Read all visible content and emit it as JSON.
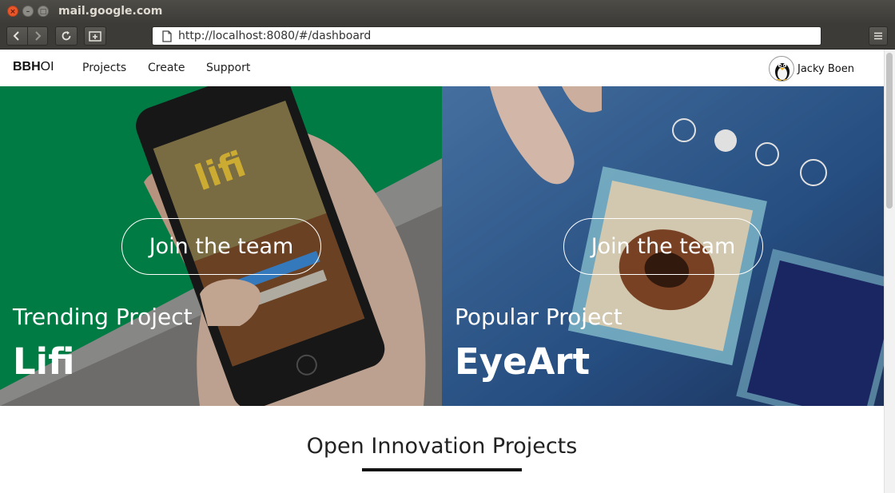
{
  "window": {
    "title": "mail.google.com",
    "buttons": {
      "close": "×",
      "minimize": "–",
      "maximize": "□"
    }
  },
  "browser": {
    "url": "http://localhost:8080/#/dashboard",
    "icons": [
      "back-icon",
      "forward-icon",
      "reload-icon",
      "new-tab-icon",
      "page-icon",
      "menu-icon"
    ]
  },
  "app": {
    "brand_bold": "BBH",
    "brand_rest": "OI",
    "nav": [
      "Projects",
      "Create",
      "Support"
    ],
    "user": {
      "name": "Jacky Boen",
      "avatar_icon": "penguin-avatar-icon"
    }
  },
  "hero": [
    {
      "cta": "Join the team",
      "kicker": "Trending Project",
      "name": "Lifi",
      "color": "#008c4e"
    },
    {
      "cta": "Join the team",
      "kicker": "Popular Project",
      "name": "EyeArt",
      "color": "#1a3e6e"
    }
  ],
  "section": {
    "title": "Open Innovation Projects"
  }
}
